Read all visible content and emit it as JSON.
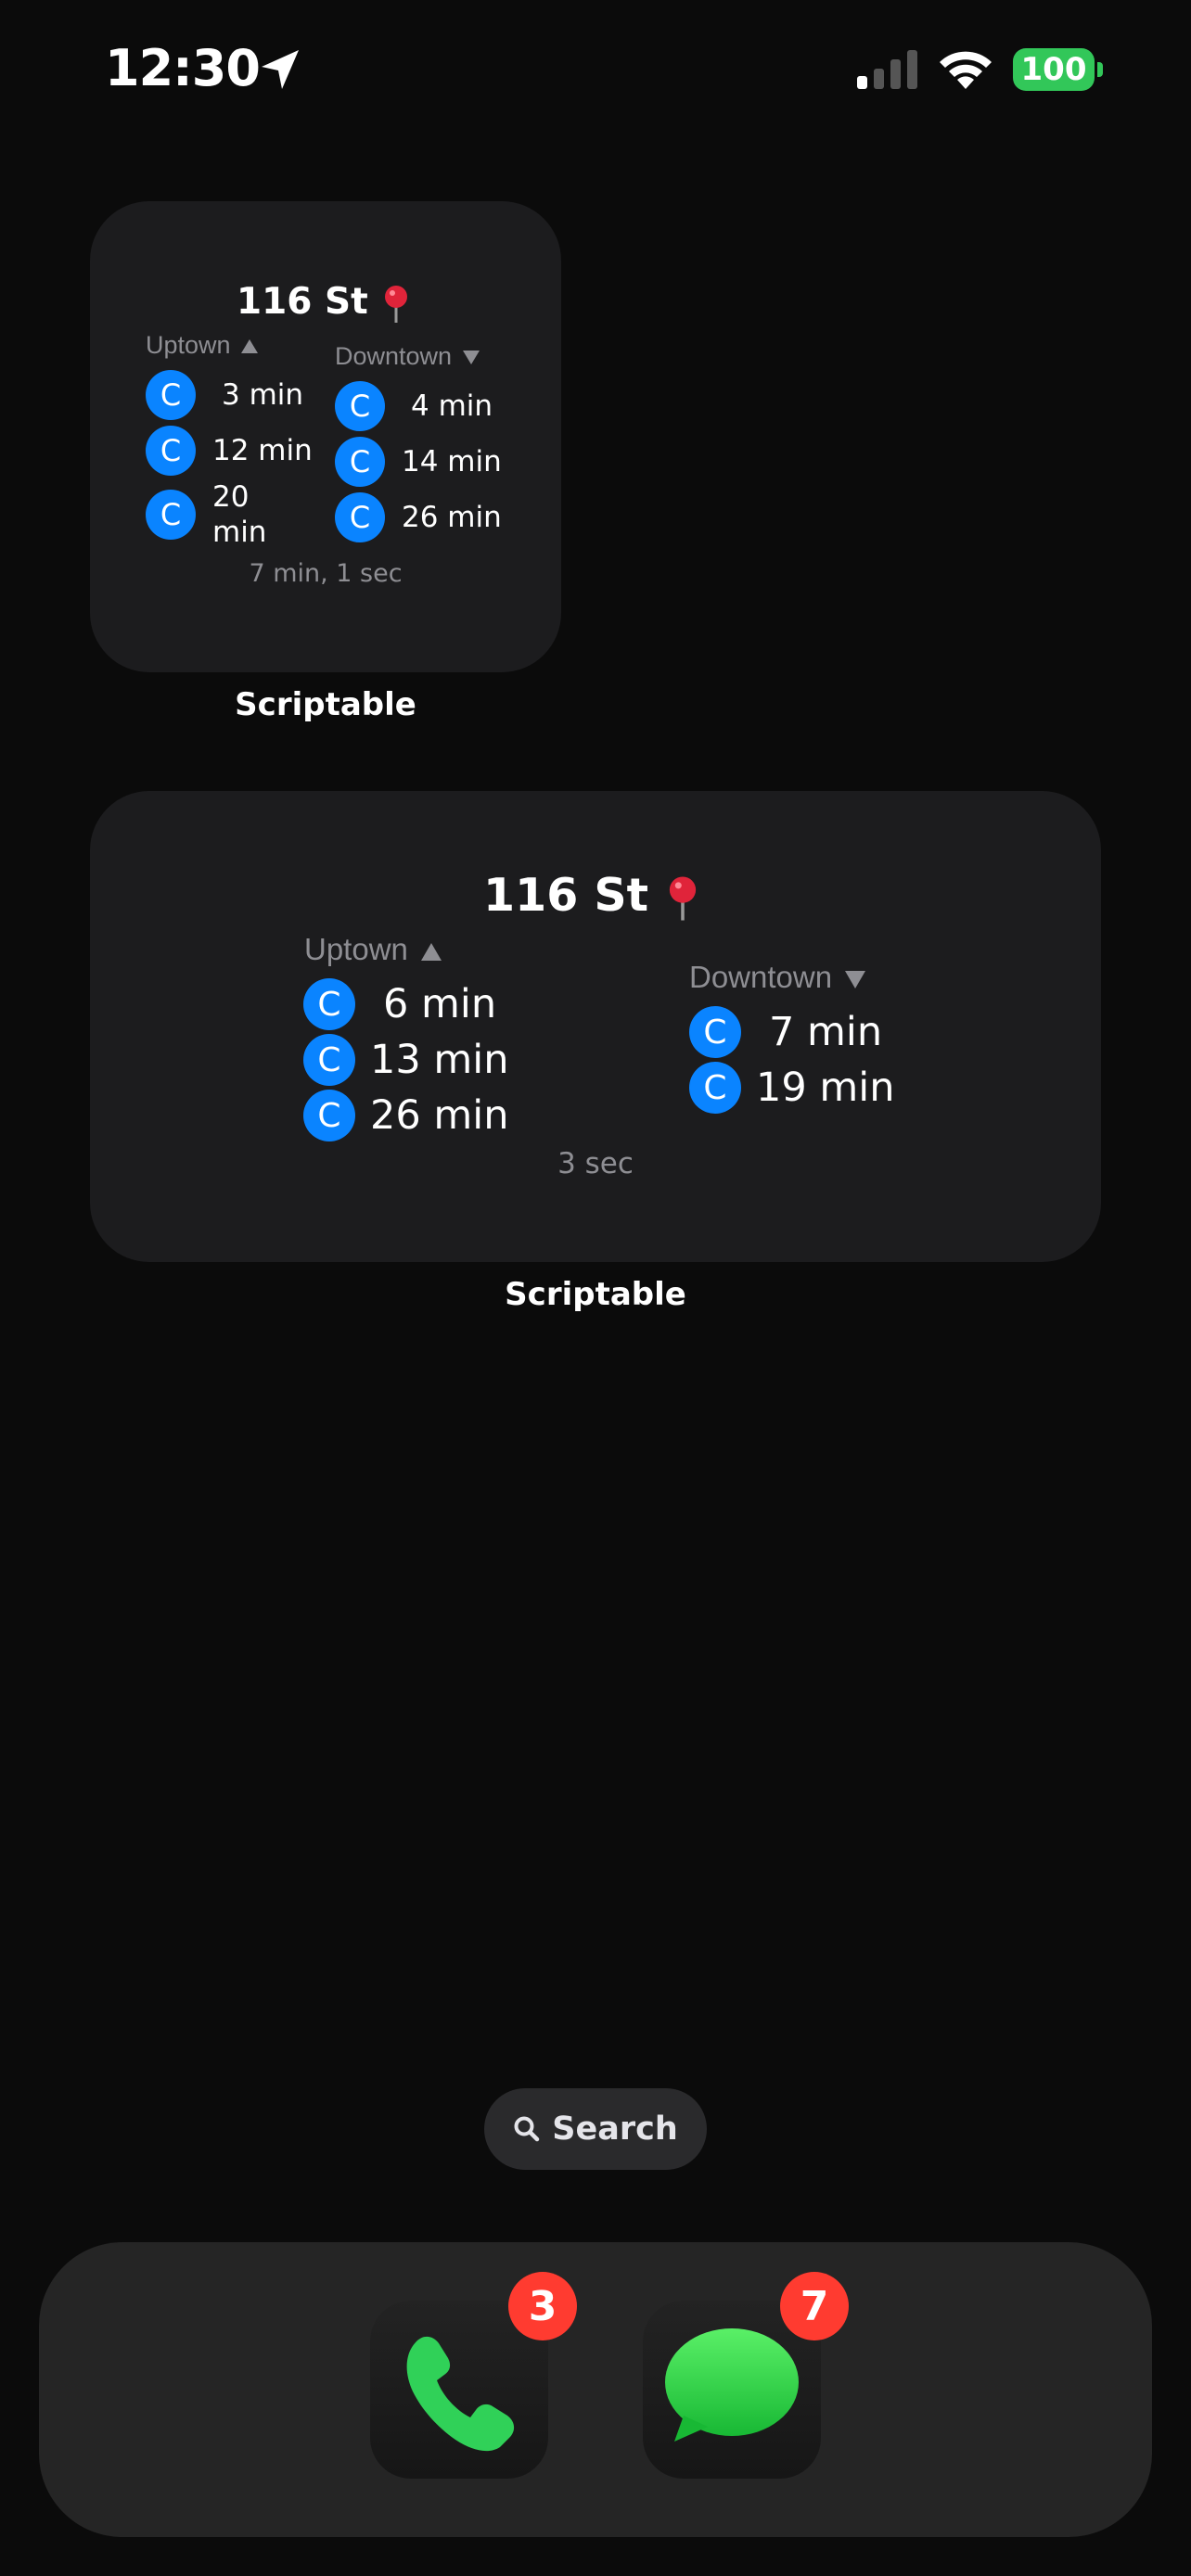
{
  "status_bar": {
    "time": "12:30",
    "battery": "100",
    "battery_color": "#32c759"
  },
  "small_widget": {
    "station": "116 St",
    "uptown": {
      "label": "Uptown",
      "trains": [
        {
          "route": "C",
          "eta": "3 min"
        },
        {
          "route": "C",
          "eta": "12 min"
        },
        {
          "route": "C",
          "eta": "20\nmin"
        }
      ]
    },
    "downtown": {
      "label": "Downtown",
      "trains": [
        {
          "route": "C",
          "eta": "4 min"
        },
        {
          "route": "C",
          "eta": "14 min"
        },
        {
          "route": "C",
          "eta": "26 min"
        }
      ]
    },
    "updated": "7 min, 1 sec",
    "caption": "Scriptable"
  },
  "medium_widget": {
    "station": "116 St",
    "uptown": {
      "label": "Uptown",
      "trains": [
        {
          "route": "C",
          "eta": "6 min"
        },
        {
          "route": "C",
          "eta": "13 min"
        },
        {
          "route": "C",
          "eta": "26 min"
        }
      ]
    },
    "downtown": {
      "label": "Downtown",
      "trains": [
        {
          "route": "C",
          "eta": "7 min"
        },
        {
          "route": "C",
          "eta": "19 min"
        }
      ]
    },
    "updated": "3 sec",
    "caption": "Scriptable"
  },
  "route_color": "#0a84ff",
  "search": {
    "label": "Search",
    "icon": "magnifying-glass-icon"
  },
  "dock": {
    "apps": [
      {
        "name": "Phone",
        "icon": "phone-icon",
        "badge": "3"
      },
      {
        "name": "Messages",
        "icon": "messages-icon",
        "badge": "7"
      }
    ],
    "badge_color": "#ff3b30"
  }
}
